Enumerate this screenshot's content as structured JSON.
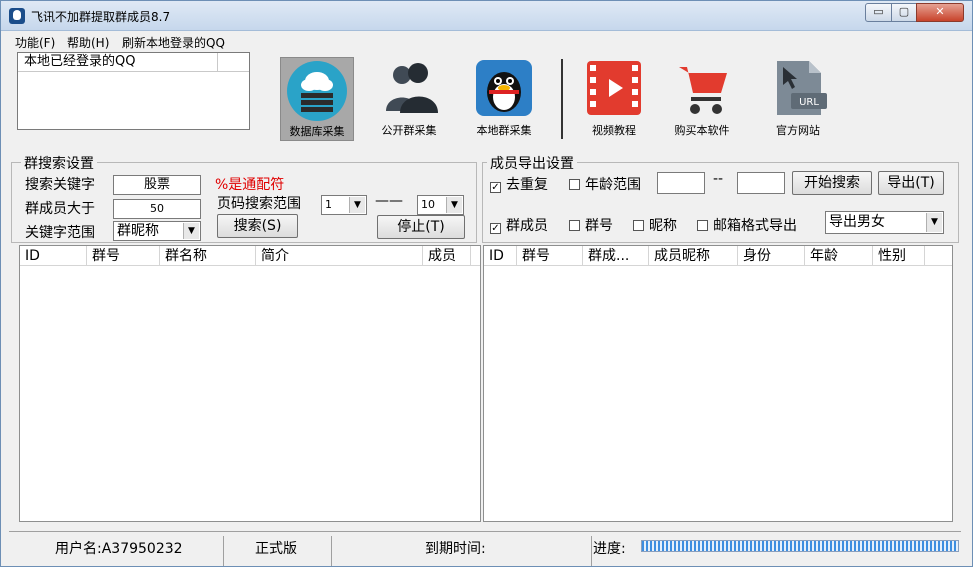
{
  "window": {
    "title": "飞讯不加群提取群成员8.7",
    "min_label": "▭",
    "max_label": "▢",
    "close_label": "✕"
  },
  "menu": {
    "function": "功能(F)",
    "help": "帮助(H)",
    "refresh": "刷新本地登录的QQ"
  },
  "qq_box": {
    "header": "本地已经登录的QQ"
  },
  "toolbar": {
    "db": "数据库采集",
    "public": "公开群采集",
    "local": "本地群采集",
    "video": "视频教程",
    "buy": "购买本软件",
    "site": "官方网站"
  },
  "search": {
    "title": "群搜索设置",
    "keyword_label": "搜索关键字",
    "keyword_value": "股票",
    "wildcard_note": "%是通配符",
    "members_label": "群成员大于",
    "members_value": "50",
    "page_label": "页码搜索范围",
    "page_from": "1",
    "page_dash": "——",
    "page_to": "10",
    "scope_label": "关键字范围",
    "scope_value": "群昵称",
    "search_button": "搜索(S)",
    "stop_button": "停止(T)"
  },
  "export": {
    "title": "成员导出设置",
    "dedupe": "去重复",
    "age_range": "年龄范围",
    "age_dash": "--",
    "start_search": "开始搜索",
    "export_button": "导出(T)",
    "group_member": "群成员",
    "group_no": "群号",
    "nickname": "昵称",
    "email_format": "邮箱格式导出",
    "gender_value": "导出男女"
  },
  "group_list": {
    "columns": [
      "ID",
      "群号",
      "群名称",
      "简介",
      "成员"
    ]
  },
  "member_list": {
    "columns": [
      "ID",
      "群号",
      "群成...",
      "成员昵称",
      "身份",
      "年龄",
      "性别"
    ]
  },
  "status": {
    "user": "用户名:A37950232",
    "edition": "正式版",
    "expiry": "到期时间:",
    "progress_label": "进度:",
    "progress": 1.0
  },
  "colors": {
    "wildcard": "#e00000",
    "progress": "#3d8ee0"
  },
  "icons": {
    "db": "cloud-database-icon",
    "public": "two-users-icon",
    "local": "qq-penguin-icon",
    "video": "film-play-icon",
    "buy": "shopping-cart-icon",
    "site": "url-document-icon"
  }
}
